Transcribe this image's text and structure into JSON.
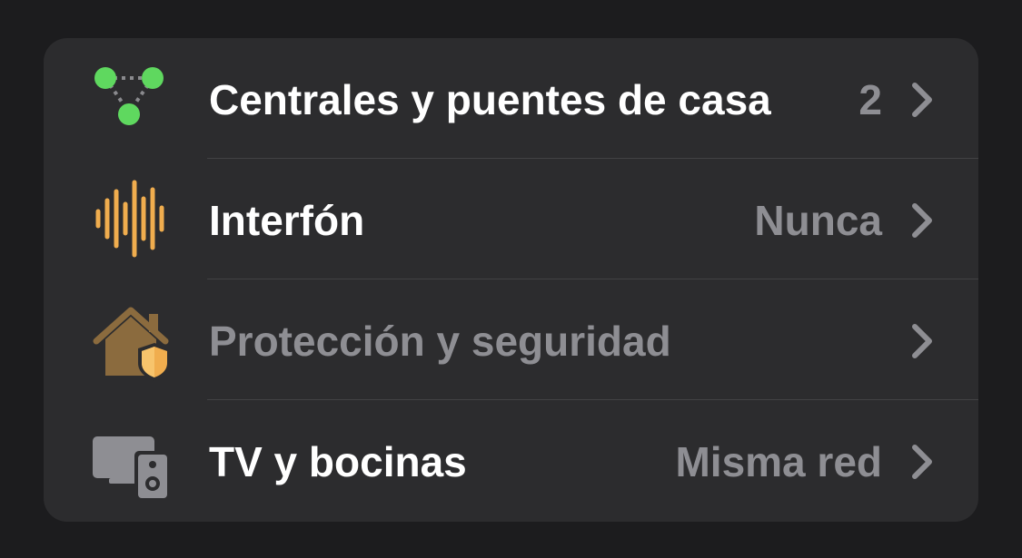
{
  "settings": {
    "rows": [
      {
        "label": "Centrales y puentes de casa",
        "value": "2",
        "icon": "home-hubs-icon",
        "dimmed": false
      },
      {
        "label": "Interfón",
        "value": "Nunca",
        "icon": "intercom-waveform-icon",
        "dimmed": false
      },
      {
        "label": "Protección y seguridad",
        "value": "",
        "icon": "home-shield-icon",
        "dimmed": true
      },
      {
        "label": "TV y bocinas",
        "value": "Misma red",
        "icon": "tv-speaker-icon",
        "dimmed": false
      }
    ]
  },
  "colors": {
    "background": "#1c1c1e",
    "card": "#2c2c2e",
    "hub_green": "#5fd85f",
    "intercom_orange": "#f0ad4e",
    "home_brown": "#8b6b3e",
    "secondary_text": "#8e8e93"
  }
}
